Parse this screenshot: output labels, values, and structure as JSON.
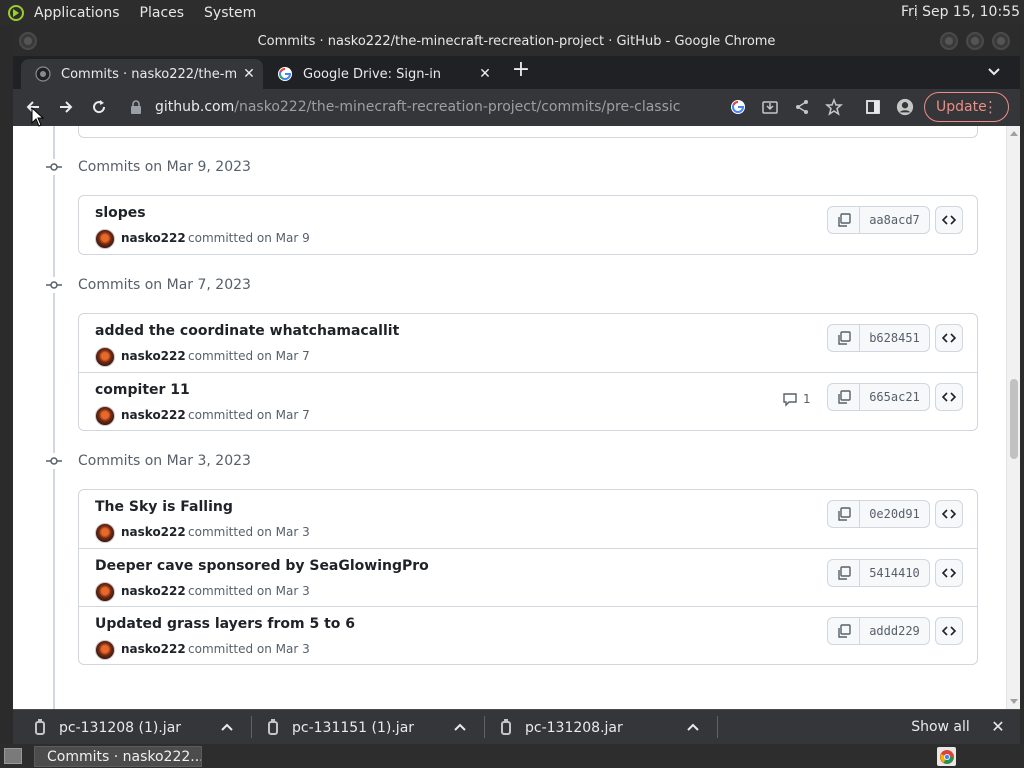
{
  "topbar": {
    "menus": [
      "Applications",
      "Places",
      "System"
    ],
    "clock": "Fri Sep 15, 10:55"
  },
  "window": {
    "title": "Commits · nasko222/the-minecraft-recreation-project · GitHub - Google Chrome"
  },
  "tabs": [
    {
      "title": "Commits · nasko222/the-minecraft-recreation-project",
      "favicon": "github-icon",
      "active": true
    },
    {
      "title": "Google Drive: Sign-in",
      "favicon": "google-icon",
      "active": false
    }
  ],
  "toolbar": {
    "url_host": "github.com",
    "url_path": "/nasko222/the-minecraft-recreation-project/commits/pre-classic",
    "update_label": "Update"
  },
  "page": {
    "groups": [
      {
        "date_label": "Commits on Mar 9, 2023",
        "commits": [
          {
            "message": "slopes",
            "author": "nasko222",
            "meta": "committed on Mar 9",
            "sha": "aa8acd7",
            "comments": ""
          }
        ]
      },
      {
        "date_label": "Commits on Mar 7, 2023",
        "commits": [
          {
            "message": "added the coordinate whatchamacallit",
            "author": "nasko222",
            "meta": "committed on Mar 7",
            "sha": "b628451",
            "comments": ""
          },
          {
            "message": "compiter 11",
            "author": "nasko222",
            "meta": "committed on Mar 7",
            "sha": "665ac21",
            "comments": "1"
          }
        ]
      },
      {
        "date_label": "Commits on Mar 3, 2023",
        "commits": [
          {
            "message": "The Sky is Falling",
            "author": "nasko222",
            "meta": "committed on Mar 3",
            "sha": "0e20d91",
            "comments": ""
          },
          {
            "message": "Deeper cave sponsored by SeaGlowingPro",
            "author": "nasko222",
            "meta": "committed on Mar 3",
            "sha": "5414410",
            "comments": ""
          },
          {
            "message": "Updated grass layers from 5 to 6",
            "author": "nasko222",
            "meta": "committed on Mar 3",
            "sha": "addd229",
            "comments": ""
          }
        ]
      }
    ]
  },
  "downloads": {
    "items": [
      "pc-131208 (1).jar",
      "pc-131151 (1).jar",
      "pc-131208.jar"
    ],
    "show_all": "Show all"
  },
  "taskbar": {
    "task_label": "Commits · nasko222..."
  },
  "colors": {
    "accent_update": "#f28b82",
    "link_text": "#1f2328",
    "muted_text": "#57606a",
    "border": "#d0d7de"
  }
}
